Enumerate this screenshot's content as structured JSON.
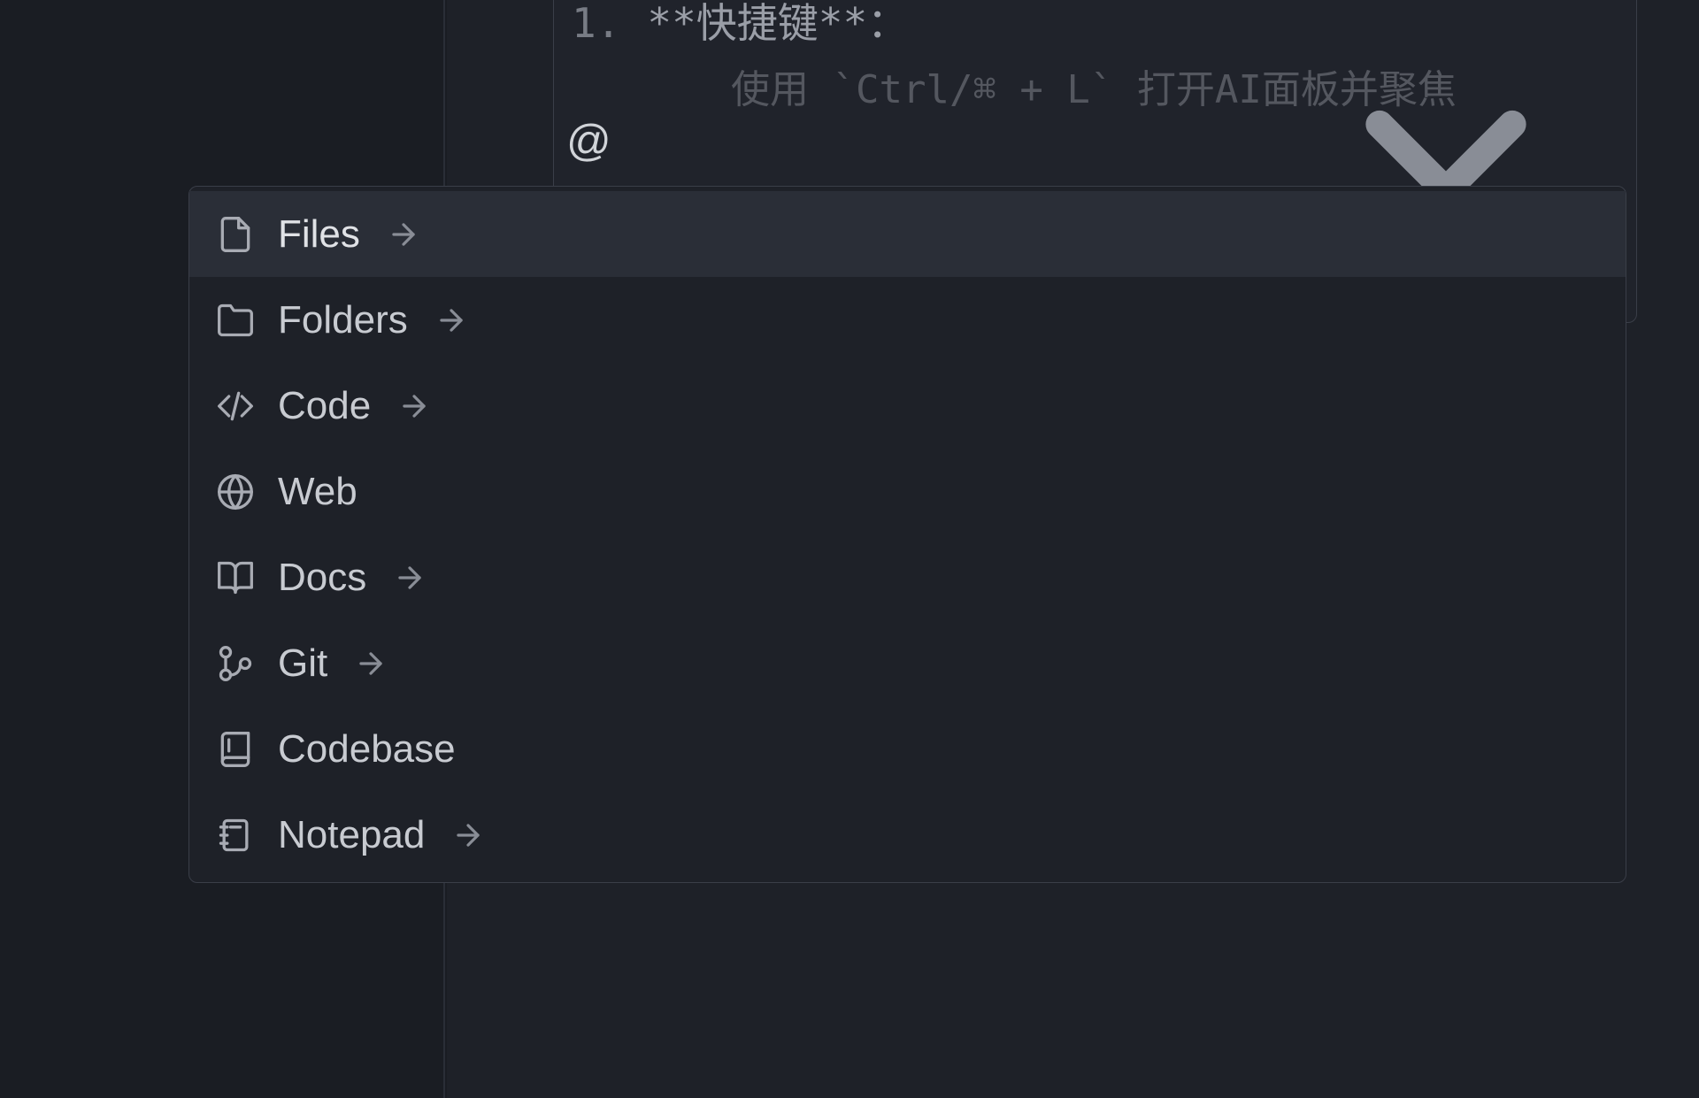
{
  "code_panel": {
    "line_number": "1.",
    "line_text": "**快捷键**：",
    "partial_line": "使用 `Ctrl/⌘ + L` 打开AI面板并聚焦",
    "at_symbol": "@"
  },
  "mention_menu": {
    "items": [
      {
        "label": "Files",
        "icon": "file",
        "has_arrow": true,
        "selected": true
      },
      {
        "label": "Folders",
        "icon": "folder",
        "has_arrow": true,
        "selected": false
      },
      {
        "label": "Code",
        "icon": "code",
        "has_arrow": true,
        "selected": false
      },
      {
        "label": "Web",
        "icon": "web",
        "has_arrow": false,
        "selected": false
      },
      {
        "label": "Docs",
        "icon": "docs",
        "has_arrow": true,
        "selected": false
      },
      {
        "label": "Git",
        "icon": "git",
        "has_arrow": true,
        "selected": false
      },
      {
        "label": "Codebase",
        "icon": "codebase",
        "has_arrow": false,
        "selected": false
      },
      {
        "label": "Notepad",
        "icon": "notepad",
        "has_arrow": true,
        "selected": false
      }
    ]
  }
}
